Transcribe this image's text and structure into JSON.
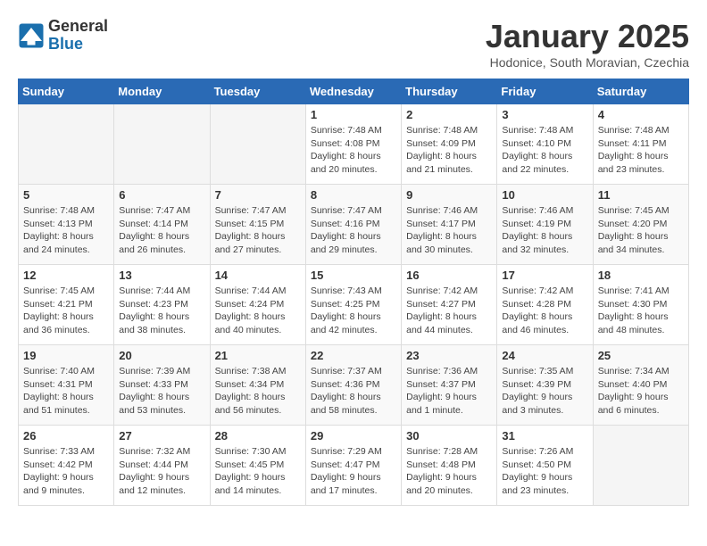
{
  "logo": {
    "general": "General",
    "blue": "Blue"
  },
  "title": "January 2025",
  "subtitle": "Hodonice, South Moravian, Czechia",
  "weekdays": [
    "Sunday",
    "Monday",
    "Tuesday",
    "Wednesday",
    "Thursday",
    "Friday",
    "Saturday"
  ],
  "weeks": [
    [
      {
        "day": "",
        "info": ""
      },
      {
        "day": "",
        "info": ""
      },
      {
        "day": "",
        "info": ""
      },
      {
        "day": "1",
        "info": "Sunrise: 7:48 AM\nSunset: 4:08 PM\nDaylight: 8 hours\nand 20 minutes."
      },
      {
        "day": "2",
        "info": "Sunrise: 7:48 AM\nSunset: 4:09 PM\nDaylight: 8 hours\nand 21 minutes."
      },
      {
        "day": "3",
        "info": "Sunrise: 7:48 AM\nSunset: 4:10 PM\nDaylight: 8 hours\nand 22 minutes."
      },
      {
        "day": "4",
        "info": "Sunrise: 7:48 AM\nSunset: 4:11 PM\nDaylight: 8 hours\nand 23 minutes."
      }
    ],
    [
      {
        "day": "5",
        "info": "Sunrise: 7:48 AM\nSunset: 4:13 PM\nDaylight: 8 hours\nand 24 minutes."
      },
      {
        "day": "6",
        "info": "Sunrise: 7:47 AM\nSunset: 4:14 PM\nDaylight: 8 hours\nand 26 minutes."
      },
      {
        "day": "7",
        "info": "Sunrise: 7:47 AM\nSunset: 4:15 PM\nDaylight: 8 hours\nand 27 minutes."
      },
      {
        "day": "8",
        "info": "Sunrise: 7:47 AM\nSunset: 4:16 PM\nDaylight: 8 hours\nand 29 minutes."
      },
      {
        "day": "9",
        "info": "Sunrise: 7:46 AM\nSunset: 4:17 PM\nDaylight: 8 hours\nand 30 minutes."
      },
      {
        "day": "10",
        "info": "Sunrise: 7:46 AM\nSunset: 4:19 PM\nDaylight: 8 hours\nand 32 minutes."
      },
      {
        "day": "11",
        "info": "Sunrise: 7:45 AM\nSunset: 4:20 PM\nDaylight: 8 hours\nand 34 minutes."
      }
    ],
    [
      {
        "day": "12",
        "info": "Sunrise: 7:45 AM\nSunset: 4:21 PM\nDaylight: 8 hours\nand 36 minutes."
      },
      {
        "day": "13",
        "info": "Sunrise: 7:44 AM\nSunset: 4:23 PM\nDaylight: 8 hours\nand 38 minutes."
      },
      {
        "day": "14",
        "info": "Sunrise: 7:44 AM\nSunset: 4:24 PM\nDaylight: 8 hours\nand 40 minutes."
      },
      {
        "day": "15",
        "info": "Sunrise: 7:43 AM\nSunset: 4:25 PM\nDaylight: 8 hours\nand 42 minutes."
      },
      {
        "day": "16",
        "info": "Sunrise: 7:42 AM\nSunset: 4:27 PM\nDaylight: 8 hours\nand 44 minutes."
      },
      {
        "day": "17",
        "info": "Sunrise: 7:42 AM\nSunset: 4:28 PM\nDaylight: 8 hours\nand 46 minutes."
      },
      {
        "day": "18",
        "info": "Sunrise: 7:41 AM\nSunset: 4:30 PM\nDaylight: 8 hours\nand 48 minutes."
      }
    ],
    [
      {
        "day": "19",
        "info": "Sunrise: 7:40 AM\nSunset: 4:31 PM\nDaylight: 8 hours\nand 51 minutes."
      },
      {
        "day": "20",
        "info": "Sunrise: 7:39 AM\nSunset: 4:33 PM\nDaylight: 8 hours\nand 53 minutes."
      },
      {
        "day": "21",
        "info": "Sunrise: 7:38 AM\nSunset: 4:34 PM\nDaylight: 8 hours\nand 56 minutes."
      },
      {
        "day": "22",
        "info": "Sunrise: 7:37 AM\nSunset: 4:36 PM\nDaylight: 8 hours\nand 58 minutes."
      },
      {
        "day": "23",
        "info": "Sunrise: 7:36 AM\nSunset: 4:37 PM\nDaylight: 9 hours\nand 1 minute."
      },
      {
        "day": "24",
        "info": "Sunrise: 7:35 AM\nSunset: 4:39 PM\nDaylight: 9 hours\nand 3 minutes."
      },
      {
        "day": "25",
        "info": "Sunrise: 7:34 AM\nSunset: 4:40 PM\nDaylight: 9 hours\nand 6 minutes."
      }
    ],
    [
      {
        "day": "26",
        "info": "Sunrise: 7:33 AM\nSunset: 4:42 PM\nDaylight: 9 hours\nand 9 minutes."
      },
      {
        "day": "27",
        "info": "Sunrise: 7:32 AM\nSunset: 4:44 PM\nDaylight: 9 hours\nand 12 minutes."
      },
      {
        "day": "28",
        "info": "Sunrise: 7:30 AM\nSunset: 4:45 PM\nDaylight: 9 hours\nand 14 minutes."
      },
      {
        "day": "29",
        "info": "Sunrise: 7:29 AM\nSunset: 4:47 PM\nDaylight: 9 hours\nand 17 minutes."
      },
      {
        "day": "30",
        "info": "Sunrise: 7:28 AM\nSunset: 4:48 PM\nDaylight: 9 hours\nand 20 minutes."
      },
      {
        "day": "31",
        "info": "Sunrise: 7:26 AM\nSunset: 4:50 PM\nDaylight: 9 hours\nand 23 minutes."
      },
      {
        "day": "",
        "info": ""
      }
    ]
  ]
}
